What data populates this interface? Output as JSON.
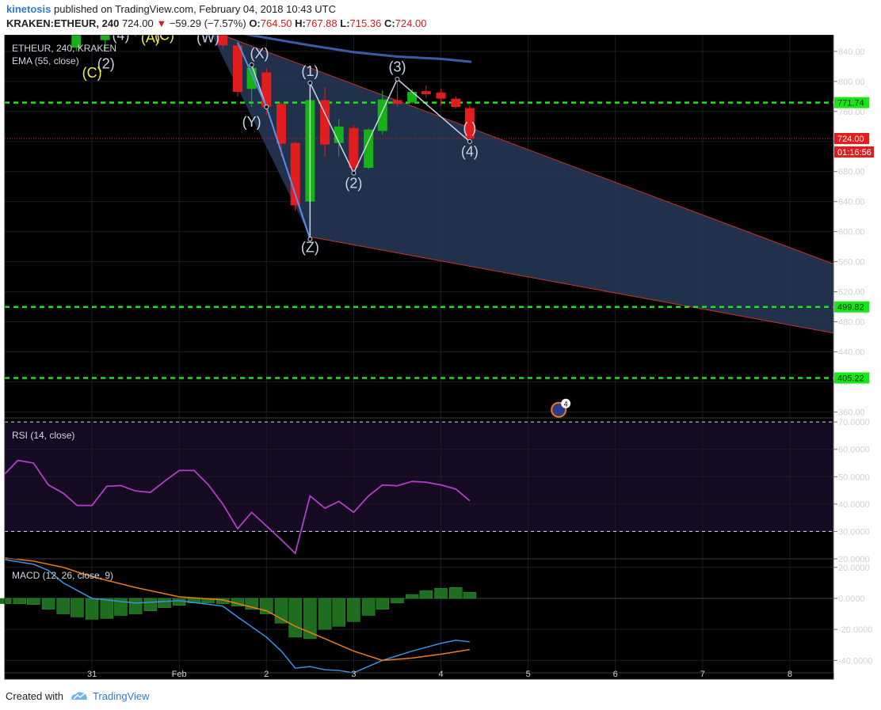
{
  "header": {
    "author": "kinetosis",
    "published": "published on TradingView.com, February 04, 2018 10:43 UTC",
    "symbol": "KRAKEN:ETHEUR, 240",
    "price": "724.00",
    "change": "−59.29 (−7.57%)",
    "o_label": "O:",
    "o_value": "764.50",
    "h_label": "H:",
    "h_value": "767.88",
    "l_label": "L:",
    "l_value": "715.36",
    "c_label": "C:",
    "c_value": "724.00"
  },
  "legend": {
    "main": "ETHEUR, 240, KRAKEN",
    "ema": "EMA (55, close)",
    "rsi": "RSI (14, close)",
    "macd": "MACD (12, 26, close, 9)"
  },
  "footer": {
    "created": "Created with",
    "brand": "TradingView"
  },
  "colors": {
    "background": "#000000",
    "up": "#18b218",
    "down": "#e11d1d",
    "level": "#19e619",
    "ema": "#3c5aa8",
    "channel_fill": "#243552",
    "rsi": "#b23cc8",
    "macd": "#3c8ee6",
    "signal": "#f07a14",
    "wave_label": "#c9d4e6",
    "wave_label_yellow": "#f0f03c"
  },
  "chart_data": [
    {
      "type": "candlestick",
      "title": "ETHEUR, 240, KRAKEN",
      "x_ticks": [
        "31",
        "Feb",
        "2",
        "3",
        "4",
        "5",
        "6",
        "7",
        "8"
      ],
      "x_tick_positions": [
        31,
        32,
        33,
        34,
        35,
        36,
        37,
        38,
        39
      ],
      "x_range": [
        30.0,
        39.5
      ],
      "ylim": [
        352,
        862
      ],
      "y_ticks": [
        360,
        400,
        440,
        480,
        520,
        560,
        600,
        640,
        680,
        720,
        760,
        800,
        840
      ],
      "y_tick_labels": [
        "360.00",
        "400.00",
        "440.00",
        "480.00",
        "520.00",
        "560.00",
        "600.00",
        "640.00",
        "680.00",
        "720.00",
        "760.00",
        "800.00",
        "840.00"
      ],
      "candles": [
        {
          "x": 30.82,
          "o": 845,
          "h": 880,
          "l": 840,
          "c": 862
        },
        {
          "x": 31.15,
          "o": 855,
          "h": 862,
          "l": 840,
          "c": 868
        },
        {
          "x": 31.5,
          "o": 870,
          "h": 885,
          "l": 860,
          "c": 876
        },
        {
          "x": 32.5,
          "o": 862,
          "h": 872,
          "l": 843,
          "c": 848
        },
        {
          "x": 32.67,
          "o": 848,
          "h": 852,
          "l": 780,
          "c": 786
        },
        {
          "x": 32.83,
          "o": 790,
          "h": 822,
          "l": 766,
          "c": 818
        },
        {
          "x": 33.0,
          "o": 812,
          "h": 818,
          "l": 755,
          "c": 766
        },
        {
          "x": 33.17,
          "o": 770,
          "h": 772,
          "l": 700,
          "c": 717
        },
        {
          "x": 33.33,
          "o": 718,
          "h": 720,
          "l": 628,
          "c": 635
        },
        {
          "x": 33.5,
          "o": 640,
          "h": 798,
          "l": 590,
          "c": 775
        },
        {
          "x": 33.67,
          "o": 775,
          "h": 792,
          "l": 700,
          "c": 716
        },
        {
          "x": 33.83,
          "o": 718,
          "h": 750,
          "l": 700,
          "c": 740
        },
        {
          "x": 34.0,
          "o": 738,
          "h": 742,
          "l": 678,
          "c": 685
        },
        {
          "x": 34.17,
          "o": 685,
          "h": 738,
          "l": 683,
          "c": 736
        },
        {
          "x": 34.33,
          "o": 734,
          "h": 788,
          "l": 730,
          "c": 776
        },
        {
          "x": 34.5,
          "o": 775,
          "h": 803,
          "l": 766,
          "c": 770
        },
        {
          "x": 34.67,
          "o": 772,
          "h": 790,
          "l": 770,
          "c": 786
        },
        {
          "x": 34.83,
          "o": 787,
          "h": 795,
          "l": 778,
          "c": 783
        },
        {
          "x": 35.0,
          "o": 785,
          "h": 790,
          "l": 768,
          "c": 777
        },
        {
          "x": 35.17,
          "o": 777,
          "h": 780,
          "l": 764,
          "c": 766
        },
        {
          "x": 35.33,
          "o": 764.5,
          "h": 767.88,
          "l": 715.36,
          "c": 724
        }
      ],
      "ema": {
        "name": "EMA (55, close)",
        "x": [
          32.6,
          33.0,
          33.5,
          34.0,
          34.5,
          35.0,
          35.35
        ],
        "y": [
          866,
          858,
          848,
          839,
          833,
          830,
          826
        ]
      },
      "levels": [
        771.74,
        499.82,
        405.22
      ],
      "level_labels": [
        "771.74",
        "499.82",
        "405.22"
      ],
      "current_price": 724.0,
      "current_price_label": "724.00",
      "countdown": "01:16:56",
      "channel": {
        "upper": [
          [
            32.35,
            868
          ],
          [
            39.5,
            557
          ]
        ],
        "lower": [
          [
            33.5,
            593
          ],
          [
            39.5,
            465
          ]
        ]
      },
      "wave_path": {
        "x": [
          32.83,
          33.0,
          33.5,
          33.5,
          34.0,
          34.5,
          35.33
        ],
        "y": [
          822,
          766,
          590,
          798,
          678,
          803,
          720
        ]
      },
      "wave_labels": [
        {
          "text": "(4)",
          "x": 31.33,
          "y": 860,
          "color": "wave"
        },
        {
          "text": "(2)",
          "x": 31.16,
          "y": 822,
          "color": "wave"
        },
        {
          "text": "(C)",
          "x": 31.0,
          "y": 810,
          "color": "yellow"
        },
        {
          "text": "(A)",
          "x": 31.67,
          "y": 857,
          "color": "yellow"
        },
        {
          "text": "(C)",
          "x": 31.83,
          "y": 860,
          "color": "yellow"
        },
        {
          "text": "(W)",
          "x": 32.33,
          "y": 857,
          "color": "wave"
        },
        {
          "text": "(X)",
          "x": 32.92,
          "y": 836,
          "color": "wave"
        },
        {
          "text": "(Y)",
          "x": 32.83,
          "y": 745,
          "color": "wave"
        },
        {
          "text": "(1)",
          "x": 33.5,
          "y": 812,
          "color": "wave"
        },
        {
          "text": "(Z)",
          "x": 33.5,
          "y": 578,
          "color": "wave"
        },
        {
          "text": "(2)",
          "x": 34.0,
          "y": 663,
          "color": "wave"
        },
        {
          "text": "(3)",
          "x": 34.5,
          "y": 818,
          "color": "wave"
        },
        {
          "text": "( )",
          "x": 35.33,
          "y": 737,
          "color": "wave"
        },
        {
          "text": "(4)",
          "x": 35.33,
          "y": 705,
          "color": "wave"
        }
      ],
      "event_badge": {
        "x": 36.35,
        "y": 366,
        "count": "4"
      }
    },
    {
      "type": "line",
      "title": "RSI (14, close)",
      "ylim": [
        20,
        71.5
      ],
      "y_ticks": [
        20,
        30,
        40,
        50,
        60,
        70
      ],
      "y_tick_labels": [
        "20.0000",
        "30.0000",
        "40.0000",
        "50.0000",
        "60.0000",
        "70.0000"
      ],
      "bands": [
        30,
        70
      ],
      "series": [
        {
          "x": [
            30.0,
            30.15,
            30.33,
            30.5,
            30.67,
            30.83,
            31.0,
            31.17,
            31.33,
            31.5,
            31.67,
            31.83,
            32.0,
            32.17,
            32.33,
            32.5,
            32.67,
            32.83,
            33.0,
            33.17,
            33.33,
            33.5,
            33.67,
            33.83,
            34.0,
            34.17,
            34.33,
            34.5,
            34.67,
            34.83,
            35.0,
            35.17,
            35.33
          ],
          "y": [
            51,
            56,
            55,
            47,
            44,
            39.5,
            39.5,
            46.5,
            46.8,
            44.8,
            44.3,
            48.3,
            52.3,
            52.3,
            47.2,
            40.0,
            31.0,
            37.0,
            32.0,
            27.0,
            22.0,
            43.0,
            38.5,
            41.0,
            37.0,
            43.0,
            47.0,
            46.7,
            48.3,
            48.0,
            47.0,
            45.5,
            41.2
          ]
        }
      ]
    },
    {
      "type": "bar+line",
      "title": "MACD (12, 26, close, 9)",
      "ylim": [
        -48,
        25.5
      ],
      "y_ticks": [
        -40,
        -20,
        0,
        20
      ],
      "y_tick_labels": [
        "-40.0000",
        "-20.0000",
        "0.0000",
        "20.0000"
      ],
      "histogram": {
        "x": [
          30.0,
          30.17,
          30.33,
          30.5,
          30.67,
          30.83,
          31.0,
          31.17,
          31.33,
          31.5,
          31.67,
          31.83,
          32.0,
          32.17,
          32.33,
          32.5,
          32.67,
          32.83,
          33.0,
          33.17,
          33.33,
          33.5,
          33.67,
          33.83,
          34.0,
          34.17,
          34.33,
          34.5,
          34.67,
          34.83,
          35.0,
          35.17,
          35.33
        ],
        "y": [
          -3.5,
          -3.5,
          -4,
          -7,
          -10,
          -12,
          -13.5,
          -13,
          -11,
          -10,
          -8,
          -6,
          -4.5,
          -3,
          -3,
          -3.5,
          -5,
          -7,
          -10,
          -16,
          -25,
          -26,
          -20,
          -18,
          -15,
          -11,
          -7,
          -3,
          2.5,
          5,
          6.5,
          7,
          4
        ]
      },
      "series": [
        {
          "name": "MACD",
          "x": [
            30.0,
            30.33,
            30.5,
            30.67,
            31.0,
            31.5,
            32.0,
            32.5,
            32.67,
            33.0,
            33.17,
            33.33,
            33.5,
            33.67,
            33.83,
            34.0,
            34.33,
            34.67,
            35.0,
            35.17,
            35.33
          ],
          "y": [
            25,
            22,
            18,
            10,
            0,
            -3,
            -1.5,
            -5,
            -12,
            -25,
            -34,
            -45,
            -44,
            -46,
            -46.5,
            -48,
            -40,
            -34,
            -29,
            -27,
            -28
          ]
        },
        {
          "name": "Signal",
          "x": [
            30.0,
            30.33,
            30.67,
            31.0,
            31.5,
            32.0,
            32.5,
            33.0,
            33.33,
            33.67,
            34.0,
            34.33,
            34.67,
            35.0,
            35.33
          ],
          "y": [
            26,
            24,
            20,
            14,
            7,
            1,
            -1,
            -8,
            -18,
            -26,
            -34,
            -40,
            -38.5,
            -36,
            -33
          ]
        }
      ]
    }
  ]
}
